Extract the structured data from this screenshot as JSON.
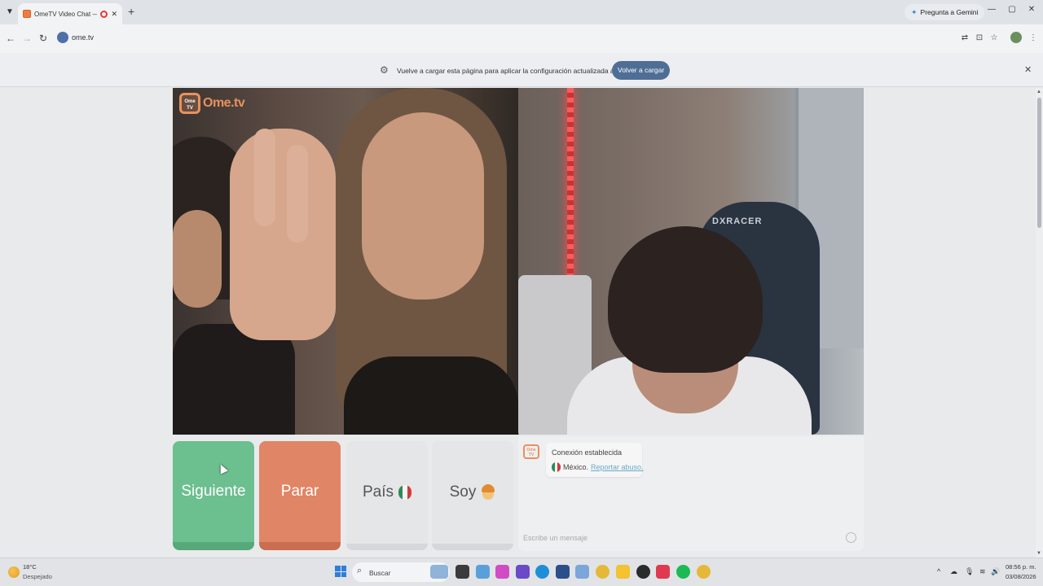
{
  "browser": {
    "tab": {
      "title": "OmeTV Video Chat — Omegle",
      "close": "✕"
    },
    "new_tab": "+",
    "gemini_label": "Pregunta a Gemini",
    "window_controls": {
      "minimize": "—",
      "restore": "▢",
      "close": "✕"
    },
    "url": "ome.tv",
    "nav": {
      "back": "←",
      "forward": "→",
      "reload": "↻"
    },
    "toolbar_icons": {
      "translate": "⇄",
      "install": "⊡",
      "bookmark": "☆",
      "menu": "⋮"
    }
  },
  "infobar": {
    "message": "Vuelve a cargar esta página para aplicar la configuración actualizada a este sitio",
    "reload_button": "Volver a cargar",
    "close": "✕"
  },
  "app": {
    "logo_text": "Ome.tv",
    "logo_badge": "Ome TV",
    "local_chair_brand": "DXRACER",
    "buttons": {
      "next": "Siguiente",
      "stop": "Parar",
      "country": "País",
      "gender": "Soy"
    },
    "chat": {
      "status": "Conexión establecida",
      "country": "México.",
      "report": "Reportar abuso.",
      "input_placeholder": "Escribe un mensaje"
    }
  },
  "taskbar": {
    "weather": {
      "temp": "18°C",
      "desc": "Despejado"
    },
    "search_label": "Buscar",
    "clock": {
      "time": "08:56 p. m.",
      "date": "03/08/2026"
    },
    "sys_icons": {
      "chevron": "^",
      "onedrive": "☁",
      "mic": "🎙",
      "wifi": "≋",
      "volume": "🔊"
    }
  },
  "colors": {
    "next_green": "#6cbf8f",
    "stop_orange": "#e08565",
    "brand_orange": "#e8915e",
    "reload_blue": "#4e6e96"
  }
}
